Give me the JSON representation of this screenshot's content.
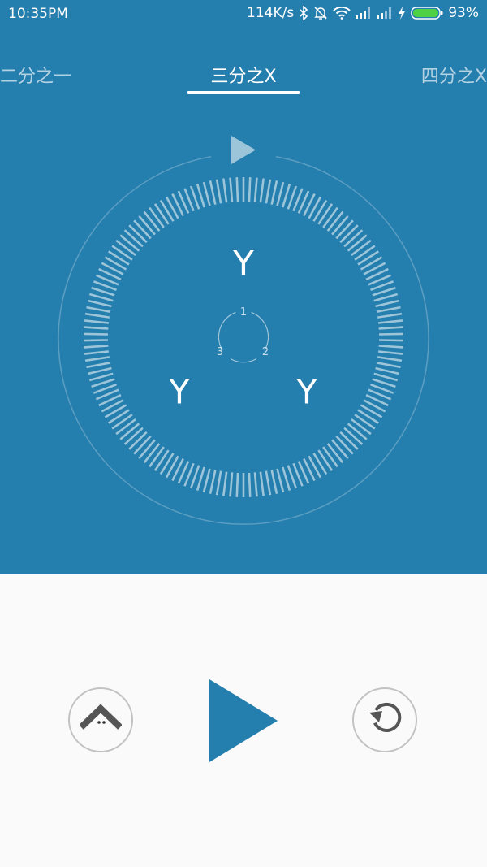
{
  "status_bar": {
    "time": "10:35PM",
    "speed": "114K/s",
    "battery": "93%",
    "icons": [
      "bluetooth-icon",
      "alarm-off-icon",
      "wifi-icon",
      "signal-icon",
      "signal-icon",
      "charging-icon",
      "battery-icon"
    ]
  },
  "tabs": [
    {
      "label": "二分之一",
      "active": false
    },
    {
      "label": "三分之X",
      "active": true
    },
    {
      "label": "四分之X",
      "active": false
    }
  ],
  "dial": {
    "beats": [
      {
        "number": "1",
        "label": "Y"
      },
      {
        "number": "2",
        "label": "Y"
      },
      {
        "number": "3",
        "label": "Y"
      }
    ]
  },
  "controls": {
    "up_icon": "chevron-up-icon",
    "play_icon": "play-icon",
    "reset_icon": "reset-icon"
  },
  "colors": {
    "primary": "#247eae",
    "background": "#fafafa",
    "button_border": "#c2c2c2",
    "icon_dark": "#555555"
  }
}
